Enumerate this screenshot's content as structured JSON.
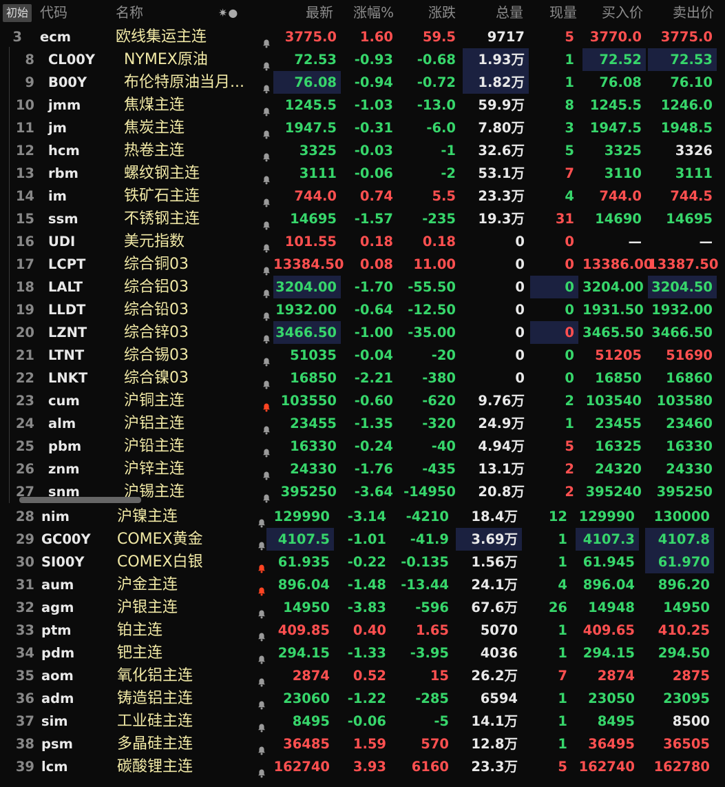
{
  "header": {
    "init_button": "初始",
    "cols": [
      "代码",
      "名称",
      "最新",
      "涨幅%",
      "涨跌",
      "总量",
      "现量",
      "买入价",
      "卖出价"
    ],
    "icons": "✷●"
  },
  "colors": {
    "up": "#ff5050",
    "down": "#37d66b",
    "name": "#f1e9a6",
    "highlight": "#1b2140",
    "alert_bell": "#ff4422"
  },
  "rows": [
    {
      "no": "3",
      "code": "ecm",
      "name": "欧线集运主连",
      "bell": "normal",
      "last": "3775.0",
      "pct": "1.60",
      "chg": "59.5",
      "vol": "9717",
      "cur": "5",
      "bid": "3770.0",
      "ask": "3775.0",
      "dir": "up",
      "bid_dir": "up",
      "ask_dir": "up",
      "cur_dir": "up",
      "hl": []
    },
    {
      "no": "8",
      "code": "CL00Y",
      "name": "NYMEX原油",
      "bell": "normal",
      "last": "72.53",
      "pct": "-0.93",
      "chg": "-0.68",
      "vol": "1.93万",
      "cur": "1",
      "bid": "72.52",
      "ask": "72.53",
      "dir": "dn",
      "bid_dir": "dn",
      "ask_dir": "dn",
      "cur_dir": "dn",
      "hl": [
        "vol",
        "bid",
        "ask"
      ]
    },
    {
      "no": "9",
      "code": "B00Y",
      "name": "布伦特原油当月...",
      "bell": "normal",
      "last": "76.08",
      "pct": "-0.94",
      "chg": "-0.72",
      "vol": "1.82万",
      "cur": "1",
      "bid": "76.08",
      "ask": "76.10",
      "dir": "dn",
      "bid_dir": "dn",
      "ask_dir": "dn",
      "cur_dir": "dn",
      "hl": [
        "last",
        "vol"
      ]
    },
    {
      "no": "10",
      "code": "jmm",
      "name": "焦煤主连",
      "bell": "normal",
      "last": "1245.5",
      "pct": "-1.03",
      "chg": "-13.0",
      "vol": "59.9万",
      "cur": "8",
      "bid": "1245.5",
      "ask": "1246.0",
      "dir": "dn",
      "bid_dir": "dn",
      "ask_dir": "dn",
      "cur_dir": "dn",
      "hl": []
    },
    {
      "no": "11",
      "code": "jm",
      "name": "焦炭主连",
      "bell": "normal",
      "last": "1947.5",
      "pct": "-0.31",
      "chg": "-6.0",
      "vol": "7.80万",
      "cur": "3",
      "bid": "1947.5",
      "ask": "1948.5",
      "dir": "dn",
      "bid_dir": "dn",
      "ask_dir": "dn",
      "cur_dir": "dn",
      "hl": []
    },
    {
      "no": "12",
      "code": "hcm",
      "name": "热卷主连",
      "bell": "normal",
      "last": "3325",
      "pct": "-0.03",
      "chg": "-1",
      "vol": "32.6万",
      "cur": "5",
      "bid": "3325",
      "ask": "3326",
      "dir": "dn",
      "bid_dir": "dn",
      "ask_dir": "wh",
      "cur_dir": "dn",
      "hl": []
    },
    {
      "no": "13",
      "code": "rbm",
      "name": "螺纹钢主连",
      "bell": "normal",
      "last": "3111",
      "pct": "-0.06",
      "chg": "-2",
      "vol": "53.1万",
      "cur": "7",
      "bid": "3110",
      "ask": "3111",
      "dir": "dn",
      "bid_dir": "dn",
      "ask_dir": "dn",
      "cur_dir": "up",
      "hl": []
    },
    {
      "no": "14",
      "code": "im",
      "name": "铁矿石主连",
      "bell": "normal",
      "last": "744.0",
      "pct": "0.74",
      "chg": "5.5",
      "vol": "23.3万",
      "cur": "4",
      "bid": "744.0",
      "ask": "744.5",
      "dir": "up",
      "bid_dir": "up",
      "ask_dir": "up",
      "cur_dir": "dn",
      "hl": []
    },
    {
      "no": "15",
      "code": "ssm",
      "name": "不锈钢主连",
      "bell": "normal",
      "last": "14695",
      "pct": "-1.57",
      "chg": "-235",
      "vol": "19.3万",
      "cur": "31",
      "bid": "14690",
      "ask": "14695",
      "dir": "dn",
      "bid_dir": "dn",
      "ask_dir": "dn",
      "cur_dir": "up",
      "hl": []
    },
    {
      "no": "16",
      "code": "UDI",
      "name": "美元指数",
      "bell": "normal",
      "last": "101.55",
      "pct": "0.18",
      "chg": "0.18",
      "vol": "0",
      "cur": "0",
      "bid": "—",
      "ask": "—",
      "dir": "up",
      "bid_dir": "wh",
      "ask_dir": "wh",
      "cur_dir": "up",
      "hl": []
    },
    {
      "no": "17",
      "code": "LCPT",
      "name": "综合铜03",
      "bell": "normal",
      "last": "13384.50",
      "pct": "0.08",
      "chg": "11.00",
      "vol": "0",
      "cur": "0",
      "bid": "13386.00",
      "ask": "13387.50",
      "dir": "up",
      "bid_dir": "up",
      "ask_dir": "up",
      "cur_dir": "up",
      "hl": []
    },
    {
      "no": "18",
      "code": "LALT",
      "name": "综合铝03",
      "bell": "normal",
      "last": "3204.00",
      "pct": "-1.70",
      "chg": "-55.50",
      "vol": "0",
      "cur": "0",
      "bid": "3204.00",
      "ask": "3204.50",
      "dir": "dn",
      "bid_dir": "dn",
      "ask_dir": "dn",
      "cur_dir": "dn",
      "hl": [
        "last",
        "cur",
        "ask"
      ]
    },
    {
      "no": "19",
      "code": "LLDT",
      "name": "综合铅03",
      "bell": "normal",
      "last": "1932.00",
      "pct": "-0.64",
      "chg": "-12.50",
      "vol": "0",
      "cur": "0",
      "bid": "1931.50",
      "ask": "1932.00",
      "dir": "dn",
      "bid_dir": "dn",
      "ask_dir": "dn",
      "cur_dir": "dn",
      "hl": []
    },
    {
      "no": "20",
      "code": "LZNT",
      "name": "综合锌03",
      "bell": "normal",
      "last": "3466.50",
      "pct": "-1.00",
      "chg": "-35.00",
      "vol": "0",
      "cur": "0",
      "bid": "3465.50",
      "ask": "3466.50",
      "dir": "dn",
      "bid_dir": "dn",
      "ask_dir": "dn",
      "cur_dir": "up",
      "hl": [
        "last",
        "cur"
      ]
    },
    {
      "no": "21",
      "code": "LTNT",
      "name": "综合锡03",
      "bell": "normal",
      "last": "51035",
      "pct": "-0.04",
      "chg": "-20",
      "vol": "0",
      "cur": "0",
      "bid": "51205",
      "ask": "51690",
      "dir": "dn",
      "bid_dir": "up",
      "ask_dir": "up",
      "cur_dir": "dn",
      "hl": []
    },
    {
      "no": "22",
      "code": "LNKT",
      "name": "综合镍03",
      "bell": "normal",
      "last": "16850",
      "pct": "-2.21",
      "chg": "-380",
      "vol": "0",
      "cur": "0",
      "bid": "16850",
      "ask": "16860",
      "dir": "dn",
      "bid_dir": "dn",
      "ask_dir": "dn",
      "cur_dir": "dn",
      "hl": []
    },
    {
      "no": "23",
      "code": "cum",
      "name": "沪铜主连",
      "bell": "alert",
      "last": "103550",
      "pct": "-0.60",
      "chg": "-620",
      "vol": "9.76万",
      "cur": "2",
      "bid": "103540",
      "ask": "103580",
      "dir": "dn",
      "bid_dir": "dn",
      "ask_dir": "dn",
      "cur_dir": "dn",
      "hl": []
    },
    {
      "no": "24",
      "code": "alm",
      "name": "沪铝主连",
      "bell": "normal",
      "last": "23455",
      "pct": "-1.35",
      "chg": "-320",
      "vol": "24.9万",
      "cur": "1",
      "bid": "23455",
      "ask": "23460",
      "dir": "dn",
      "bid_dir": "dn",
      "ask_dir": "dn",
      "cur_dir": "dn",
      "hl": []
    },
    {
      "no": "25",
      "code": "pbm",
      "name": "沪铅主连",
      "bell": "normal",
      "last": "16330",
      "pct": "-0.24",
      "chg": "-40",
      "vol": "4.94万",
      "cur": "5",
      "bid": "16325",
      "ask": "16330",
      "dir": "dn",
      "bid_dir": "dn",
      "ask_dir": "dn",
      "cur_dir": "up",
      "hl": []
    },
    {
      "no": "26",
      "code": "znm",
      "name": "沪锌主连",
      "bell": "normal",
      "last": "24330",
      "pct": "-1.76",
      "chg": "-435",
      "vol": "13.1万",
      "cur": "2",
      "bid": "24320",
      "ask": "24330",
      "dir": "dn",
      "bid_dir": "dn",
      "ask_dir": "dn",
      "cur_dir": "up",
      "hl": []
    },
    {
      "no": "27",
      "code": "snm",
      "name": "沪锡主连",
      "bell": "normal",
      "last": "395250",
      "pct": "-3.64",
      "chg": "-14950",
      "vol": "20.8万",
      "cur": "2",
      "bid": "395240",
      "ask": "395250",
      "dir": "dn",
      "bid_dir": "dn",
      "ask_dir": "dn",
      "cur_dir": "up",
      "hl": []
    },
    {
      "no": "28",
      "code": "nim",
      "name": "沪镍主连",
      "bell": "normal",
      "last": "129990",
      "pct": "-3.14",
      "chg": "-4210",
      "vol": "18.4万",
      "cur": "12",
      "bid": "129990",
      "ask": "130000",
      "dir": "dn",
      "bid_dir": "dn",
      "ask_dir": "dn",
      "cur_dir": "dn",
      "hl": []
    },
    {
      "no": "29",
      "code": "GC00Y",
      "name": "COMEX黄金",
      "bell": "normal",
      "last": "4107.5",
      "pct": "-1.01",
      "chg": "-41.9",
      "vol": "3.69万",
      "cur": "1",
      "bid": "4107.3",
      "ask": "4107.8",
      "dir": "dn",
      "bid_dir": "dn",
      "ask_dir": "dn",
      "cur_dir": "dn",
      "hl": [
        "last",
        "vol",
        "bid",
        "ask"
      ]
    },
    {
      "no": "30",
      "code": "SI00Y",
      "name": "COMEX白银",
      "bell": "alert",
      "last": "61.935",
      "pct": "-0.22",
      "chg": "-0.135",
      "vol": "1.56万",
      "cur": "1",
      "bid": "61.945",
      "ask": "61.970",
      "dir": "dn",
      "bid_dir": "dn",
      "ask_dir": "dn",
      "cur_dir": "dn",
      "hl": [
        "ask"
      ]
    },
    {
      "no": "31",
      "code": "aum",
      "name": "沪金主连",
      "bell": "alert",
      "last": "896.04",
      "pct": "-1.48",
      "chg": "-13.44",
      "vol": "24.1万",
      "cur": "4",
      "bid": "896.04",
      "ask": "896.20",
      "dir": "dn",
      "bid_dir": "dn",
      "ask_dir": "dn",
      "cur_dir": "dn",
      "hl": []
    },
    {
      "no": "32",
      "code": "agm",
      "name": "沪银主连",
      "bell": "normal",
      "last": "14950",
      "pct": "-3.83",
      "chg": "-596",
      "vol": "67.6万",
      "cur": "26",
      "bid": "14948",
      "ask": "14950",
      "dir": "dn",
      "bid_dir": "dn",
      "ask_dir": "dn",
      "cur_dir": "dn",
      "hl": []
    },
    {
      "no": "33",
      "code": "ptm",
      "name": "铂主连",
      "bell": "normal",
      "last": "409.85",
      "pct": "0.40",
      "chg": "1.65",
      "vol": "5070",
      "cur": "1",
      "bid": "409.65",
      "ask": "410.25",
      "dir": "up",
      "bid_dir": "up",
      "ask_dir": "up",
      "cur_dir": "dn",
      "hl": []
    },
    {
      "no": "34",
      "code": "pdm",
      "name": "钯主连",
      "bell": "normal",
      "last": "294.15",
      "pct": "-1.33",
      "chg": "-3.95",
      "vol": "4036",
      "cur": "1",
      "bid": "294.15",
      "ask": "294.50",
      "dir": "dn",
      "bid_dir": "dn",
      "ask_dir": "dn",
      "cur_dir": "dn",
      "hl": []
    },
    {
      "no": "35",
      "code": "aom",
      "name": "氧化铝主连",
      "bell": "normal",
      "last": "2874",
      "pct": "0.52",
      "chg": "15",
      "vol": "26.2万",
      "cur": "7",
      "bid": "2874",
      "ask": "2875",
      "dir": "up",
      "bid_dir": "up",
      "ask_dir": "up",
      "cur_dir": "up",
      "hl": []
    },
    {
      "no": "36",
      "code": "adm",
      "name": "铸造铝主连",
      "bell": "normal",
      "last": "23060",
      "pct": "-1.22",
      "chg": "-285",
      "vol": "6594",
      "cur": "1",
      "bid": "23050",
      "ask": "23095",
      "dir": "dn",
      "bid_dir": "dn",
      "ask_dir": "dn",
      "cur_dir": "dn",
      "hl": []
    },
    {
      "no": "37",
      "code": "sim",
      "name": "工业硅主连",
      "bell": "normal",
      "last": "8495",
      "pct": "-0.06",
      "chg": "-5",
      "vol": "14.1万",
      "cur": "1",
      "bid": "8495",
      "ask": "8500",
      "dir": "dn",
      "bid_dir": "dn",
      "ask_dir": "wh",
      "cur_dir": "dn",
      "hl": []
    },
    {
      "no": "38",
      "code": "psm",
      "name": "多晶硅主连",
      "bell": "normal",
      "last": "36485",
      "pct": "1.59",
      "chg": "570",
      "vol": "12.8万",
      "cur": "1",
      "bid": "36495",
      "ask": "36505",
      "dir": "up",
      "bid_dir": "up",
      "ask_dir": "up",
      "cur_dir": "dn",
      "hl": []
    },
    {
      "no": "39",
      "code": "lcm",
      "name": "碳酸锂主连",
      "bell": "normal",
      "last": "162740",
      "pct": "3.93",
      "chg": "6160",
      "vol": "23.3万",
      "cur": "5",
      "bid": "162740",
      "ask": "162780",
      "dir": "up",
      "bid_dir": "up",
      "ask_dir": "up",
      "cur_dir": "up",
      "hl": []
    }
  ]
}
